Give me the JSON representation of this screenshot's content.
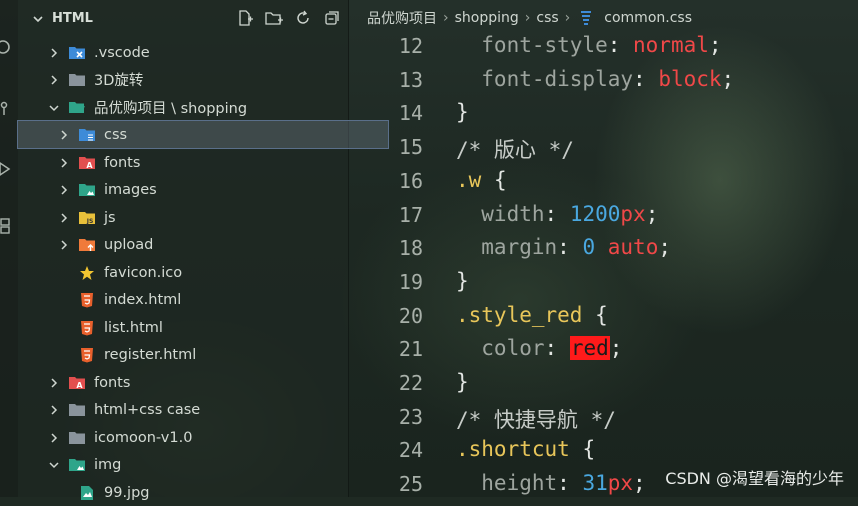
{
  "explorer": {
    "title": "HTML",
    "items": [
      {
        "label": ".vscode",
        "type": "folder",
        "icon": "vscode-folder-icon",
        "color": "#3d8bd8",
        "expanded": false,
        "depth": 1
      },
      {
        "label": "3D旋转",
        "type": "folder",
        "icon": "folder-icon",
        "color": "#8a949c",
        "expanded": false,
        "depth": 1
      },
      {
        "label": "品优购项目 \\ shopping",
        "type": "folder",
        "icon": "folder-open-icon",
        "color": "#2fa58a",
        "expanded": true,
        "depth": 1
      },
      {
        "label": "css",
        "type": "folder",
        "icon": "css-folder-icon",
        "color": "#3d8bd8",
        "expanded": false,
        "depth": 2,
        "selected": true
      },
      {
        "label": "fonts",
        "type": "folder",
        "icon": "fonts-folder-icon",
        "color": "#e24f4f",
        "expanded": false,
        "depth": 2
      },
      {
        "label": "images",
        "type": "folder",
        "icon": "images-folder-icon",
        "color": "#2fa58a",
        "expanded": false,
        "depth": 2
      },
      {
        "label": "js",
        "type": "folder",
        "icon": "js-folder-icon",
        "color": "#e8c03a",
        "expanded": false,
        "depth": 2
      },
      {
        "label": "upload",
        "type": "folder",
        "icon": "upload-folder-icon",
        "color": "#f07a3a",
        "expanded": false,
        "depth": 2
      },
      {
        "label": "favicon.ico",
        "type": "file",
        "icon": "star-icon",
        "color": "#f2c531",
        "depth": 2
      },
      {
        "label": "index.html",
        "type": "file",
        "icon": "html5-icon",
        "color": "#e8602c",
        "depth": 2
      },
      {
        "label": "list.html",
        "type": "file",
        "icon": "html5-icon",
        "color": "#e8602c",
        "depth": 2
      },
      {
        "label": "register.html",
        "type": "file",
        "icon": "html5-icon",
        "color": "#e8602c",
        "depth": 2
      },
      {
        "label": "fonts",
        "type": "folder",
        "icon": "fonts-folder-icon",
        "color": "#e24f4f",
        "expanded": false,
        "depth": 1
      },
      {
        "label": "html+css case",
        "type": "folder",
        "icon": "folder-icon",
        "color": "#8a949c",
        "expanded": false,
        "depth": 1
      },
      {
        "label": "icomoon-v1.0",
        "type": "folder",
        "icon": "folder-icon",
        "color": "#8a949c",
        "expanded": false,
        "depth": 1
      },
      {
        "label": "img",
        "type": "folder",
        "icon": "images-folder-icon",
        "color": "#2fa58a",
        "expanded": true,
        "depth": 1
      },
      {
        "label": "99.jpg",
        "type": "file",
        "icon": "image-file-icon",
        "color": "#2fa58a",
        "depth": 2
      }
    ]
  },
  "breadcrumb": {
    "parts": [
      "品优购项目",
      "shopping",
      "css"
    ],
    "file": "common.css",
    "file_icon": "css3-icon"
  },
  "code": {
    "lines": [
      {
        "n": "12",
        "tokens": [
          [
            "prop",
            "  font-style"
          ],
          [
            "punct",
            ": "
          ],
          [
            "val",
            "normal"
          ],
          [
            "punct",
            ";"
          ]
        ]
      },
      {
        "n": "13",
        "tokens": [
          [
            "prop",
            "  font-display"
          ],
          [
            "punct",
            ": "
          ],
          [
            "val",
            "block"
          ],
          [
            "punct",
            ";"
          ]
        ]
      },
      {
        "n": "14",
        "tokens": [
          [
            "brace",
            "}"
          ]
        ]
      },
      {
        "n": "15",
        "tokens": [
          [
            "cmt",
            "/* 版心 */"
          ]
        ]
      },
      {
        "n": "16",
        "tokens": [
          [
            "sel",
            ".w"
          ],
          [
            "punct",
            " "
          ],
          [
            "brace",
            "{"
          ]
        ]
      },
      {
        "n": "17",
        "tokens": [
          [
            "prop",
            "  width"
          ],
          [
            "punct",
            ": "
          ],
          [
            "num",
            "1200"
          ],
          [
            "val",
            "px"
          ],
          [
            "punct",
            ";"
          ]
        ]
      },
      {
        "n": "18",
        "tokens": [
          [
            "prop",
            "  margin"
          ],
          [
            "punct",
            ": "
          ],
          [
            "num",
            "0"
          ],
          [
            "punct",
            " "
          ],
          [
            "val",
            "auto"
          ],
          [
            "punct",
            ";"
          ]
        ]
      },
      {
        "n": "19",
        "tokens": [
          [
            "brace",
            "}"
          ]
        ]
      },
      {
        "n": "20",
        "tokens": [
          [
            "sel",
            ".style_red"
          ],
          [
            "punct",
            " "
          ],
          [
            "brace",
            "{"
          ]
        ]
      },
      {
        "n": "21",
        "tokens": [
          [
            "prop",
            "  color"
          ],
          [
            "punct",
            ": "
          ],
          [
            "hl",
            "red"
          ],
          [
            "punct",
            ";"
          ]
        ]
      },
      {
        "n": "22",
        "tokens": [
          [
            "brace",
            "}"
          ]
        ]
      },
      {
        "n": "23",
        "tokens": [
          [
            "cmt",
            "/* 快捷导航 */"
          ]
        ]
      },
      {
        "n": "24",
        "tokens": [
          [
            "sel",
            ".shortcut"
          ],
          [
            "punct",
            " "
          ],
          [
            "brace",
            "{"
          ]
        ]
      },
      {
        "n": "25",
        "tokens": [
          [
            "prop",
            "  height"
          ],
          [
            "punct",
            ": "
          ],
          [
            "num",
            "31"
          ],
          [
            "val",
            "px"
          ],
          [
            "punct",
            ";"
          ]
        ]
      }
    ]
  },
  "watermark": "CSDN @渴望看海的少年"
}
